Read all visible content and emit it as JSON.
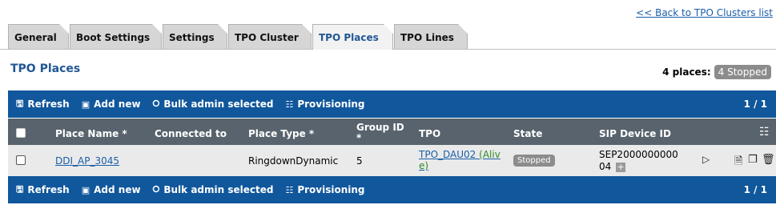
{
  "header": {
    "back_link": "<< Back to TPO Clusters list"
  },
  "tabs": [
    {
      "label": "General"
    },
    {
      "label": "Boot Settings"
    },
    {
      "label": "Settings"
    },
    {
      "label": "TPO Cluster"
    },
    {
      "label": "TPO Places",
      "active": true
    },
    {
      "label": "TPO Lines"
    }
  ],
  "section": {
    "title": "TPO Places",
    "count_label": "4 places:",
    "status_badge": "4 Stopped"
  },
  "toolbar": {
    "refresh": "Refresh",
    "add_new": "Add new",
    "bulk_admin": "Bulk admin selected",
    "provisioning": "Provisioning",
    "page": "1 / 1"
  },
  "table": {
    "headers": {
      "place_name": "Place Name *",
      "connected_to": "Connected to",
      "place_type": "Place Type *",
      "group_id_1": "Group ID",
      "group_id_2": "*",
      "tpo": "TPO",
      "state": "State",
      "sip_device_id": "SIP Device ID"
    },
    "rows": [
      {
        "place_name": "DDI_AP_3045",
        "connected_to": "",
        "place_type": "RingdownDynamic",
        "group_id": "5",
        "tpo_line1_a": "TPO_DAU02",
        "tpo_line1_b": "(Aliv",
        "tpo_line2": "e)",
        "state": "Stopped",
        "sip_line1": "SEP2000000000",
        "sip_line2": "04"
      }
    ]
  },
  "icons": {
    "refresh": "refresh-icon",
    "add": "add-icon",
    "bulk": "bulk-admin-icon",
    "provisioning": "provisioning-icon",
    "columns": "column-chooser-icon",
    "play": "play-icon",
    "edit": "edit-icon",
    "copy": "copy-icon",
    "delete": "trash-icon"
  }
}
